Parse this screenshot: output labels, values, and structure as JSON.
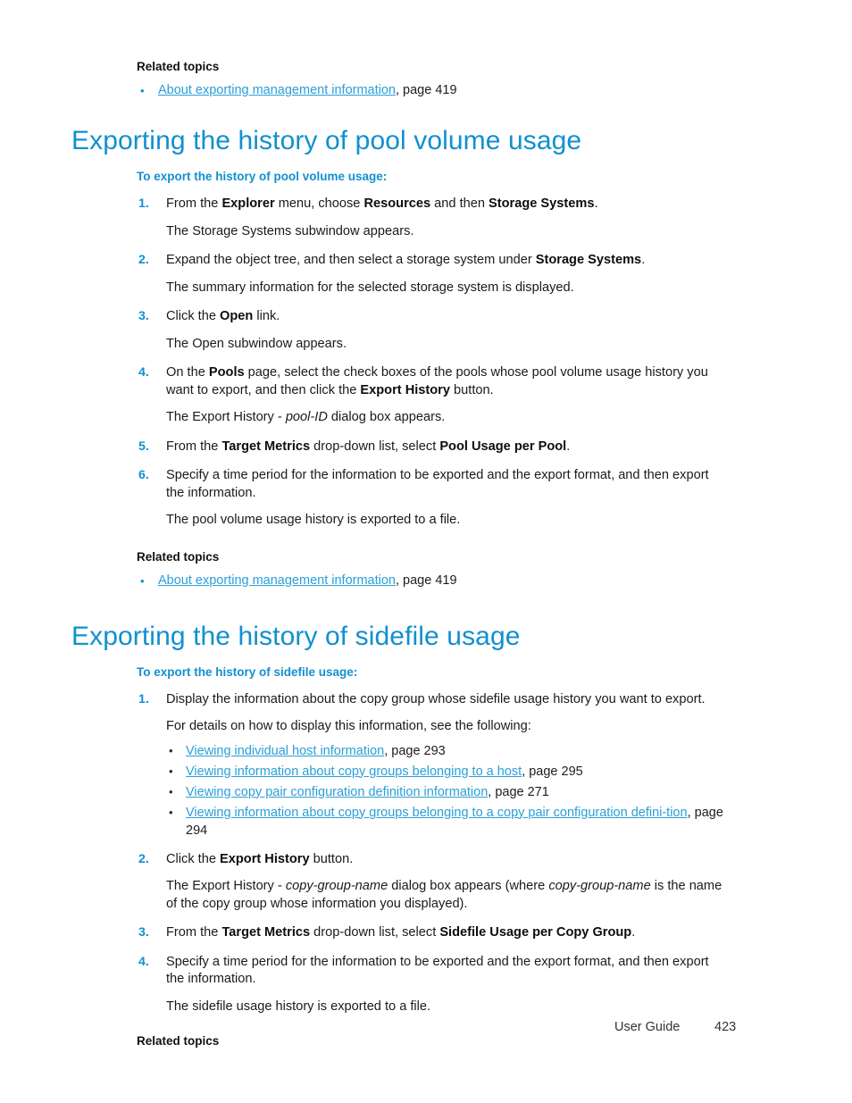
{
  "document": {
    "accent_blue": "#1190cf",
    "link_blue": "#2a9fd8",
    "body_black": "#1a1a1a"
  },
  "top_related": {
    "label": "Related topics",
    "items": [
      {
        "bullet": "•",
        "link": "About exporting management information",
        "page": ", page 419"
      }
    ]
  },
  "sections": [
    {
      "title": "Exporting the history of pool volume usage",
      "subhead": "To export the history of pool volume usage:",
      "steps": [
        {
          "num": "1.",
          "parts": [
            {
              "t": "text",
              "v": "From the "
            },
            {
              "t": "bold",
              "v": "Explorer"
            },
            {
              "t": "text",
              "v": " menu, choose "
            },
            {
              "t": "bold",
              "v": "Resources"
            },
            {
              "t": "text",
              "v": " and then "
            },
            {
              "t": "bold",
              "v": "Storage Systems"
            },
            {
              "t": "text",
              "v": "."
            }
          ],
          "result": "The Storage Systems subwindow appears."
        },
        {
          "num": "2.",
          "parts": [
            {
              "t": "text",
              "v": "Expand the object tree, and then select a storage system under "
            },
            {
              "t": "bold",
              "v": "Storage Systems"
            },
            {
              "t": "text",
              "v": "."
            }
          ],
          "result": "The summary information for the selected storage system is displayed."
        },
        {
          "num": "3.",
          "parts": [
            {
              "t": "text",
              "v": "Click the "
            },
            {
              "t": "bold",
              "v": "Open"
            },
            {
              "t": "text",
              "v": " link."
            }
          ],
          "result": "The Open subwindow appears."
        },
        {
          "num": "4.",
          "parts": [
            {
              "t": "text",
              "v": "On the "
            },
            {
              "t": "bold",
              "v": "Pools"
            },
            {
              "t": "text",
              "v": " page, select the check boxes of the pools whose pool volume usage history you want to export, and then click the "
            },
            {
              "t": "bold",
              "v": "Export History"
            },
            {
              "t": "text",
              "v": " button."
            }
          ],
          "result_parts": [
            {
              "t": "text",
              "v": "The Export History - "
            },
            {
              "t": "italic",
              "v": "pool-ID"
            },
            {
              "t": "text",
              "v": " dialog box appears."
            }
          ]
        },
        {
          "num": "5.",
          "parts": [
            {
              "t": "text",
              "v": "From the "
            },
            {
              "t": "bold",
              "v": "Target Metrics"
            },
            {
              "t": "text",
              "v": " drop-down list, select "
            },
            {
              "t": "bold",
              "v": "Pool Usage per Pool"
            },
            {
              "t": "text",
              "v": "."
            }
          ]
        },
        {
          "num": "6.",
          "parts": [
            {
              "t": "text",
              "v": "Specify a time period for the information to be exported and the export format, and then export the information."
            }
          ],
          "result": "The pool volume usage history is exported to a file."
        }
      ],
      "related": {
        "label": "Related topics",
        "items": [
          {
            "bullet": "•",
            "link": "About exporting management information",
            "page": ", page 419"
          }
        ]
      }
    },
    {
      "title": "Exporting the history of sidefile usage",
      "subhead": "To export the history of sidefile usage:",
      "steps": [
        {
          "num": "1.",
          "parts": [
            {
              "t": "text",
              "v": "Display the information about the copy group whose sidefile usage history you want to export."
            }
          ],
          "lead_in": "For details on how to display this information, see the following:",
          "sublist": [
            {
              "bullet": "•",
              "link": "Viewing individual host information",
              "page": ", page 293"
            },
            {
              "bullet": "•",
              "link": "Viewing information about copy groups belonging to a host",
              "page": ", page 295"
            },
            {
              "bullet": "•",
              "link": "Viewing copy pair configuration definition information",
              "page": ", page 271"
            },
            {
              "bullet": "•",
              "link": "Viewing information about copy groups belonging to a copy pair configuration defini-tion",
              "page": ", page 294"
            }
          ]
        },
        {
          "num": "2.",
          "parts": [
            {
              "t": "text",
              "v": "Click the "
            },
            {
              "t": "bold",
              "v": "Export History"
            },
            {
              "t": "text",
              "v": " button."
            }
          ],
          "result_parts": [
            {
              "t": "text",
              "v": "The Export History - "
            },
            {
              "t": "italic",
              "v": "copy-group-name"
            },
            {
              "t": "text",
              "v": " dialog box appears (where "
            },
            {
              "t": "italic",
              "v": "copy-group-name"
            },
            {
              "t": "text",
              "v": " is the name of the copy group whose information you displayed)."
            }
          ]
        },
        {
          "num": "3.",
          "parts": [
            {
              "t": "text",
              "v": "From the "
            },
            {
              "t": "bold",
              "v": "Target Metrics"
            },
            {
              "t": "text",
              "v": " drop-down list, select "
            },
            {
              "t": "bold",
              "v": "Sidefile Usage per Copy Group"
            },
            {
              "t": "text",
              "v": "."
            }
          ]
        },
        {
          "num": "4.",
          "parts": [
            {
              "t": "text",
              "v": "Specify a time period for the information to be exported and the export format, and then export the information."
            }
          ],
          "result": "The sidefile usage history is exported to a file."
        }
      ],
      "related": {
        "label": "Related topics",
        "items": []
      }
    }
  ],
  "footer": {
    "guide": "User Guide",
    "page_number": "423"
  }
}
